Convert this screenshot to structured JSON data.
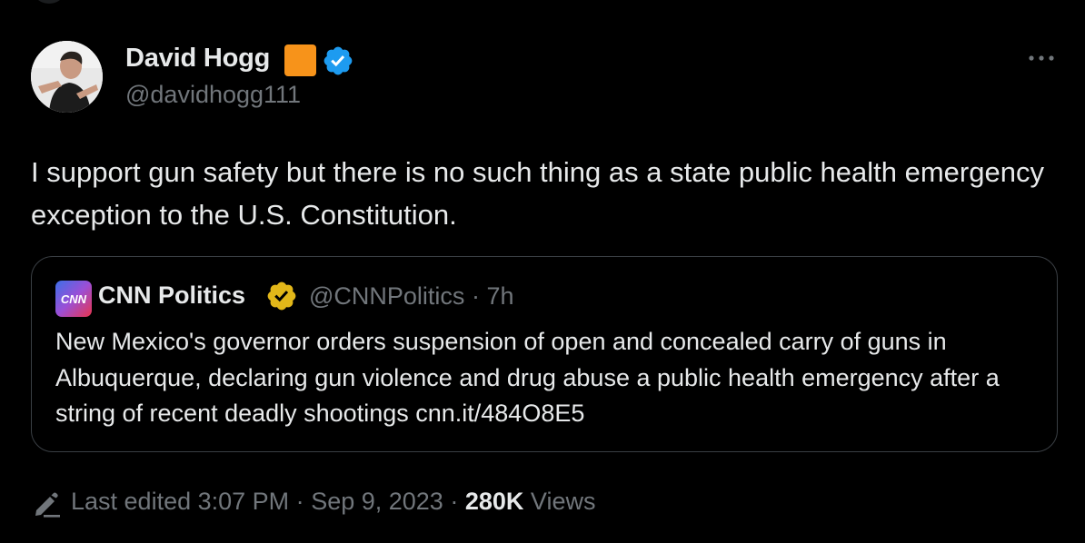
{
  "author": {
    "display_name": "David Hogg",
    "handle": "@davidhogg111",
    "badge_color": "#f7931a",
    "verified_color": "#1d9bf0"
  },
  "tweet": {
    "text": "I support gun safety but there is no such thing as a state public health emergency exception to the U.S. Constitution."
  },
  "quote": {
    "logo_text": "CNN",
    "display_name": "CNN Politics",
    "handle": "@CNNPolitics",
    "separator": "·",
    "time": "7h",
    "text": "New Mexico's governor orders suspension of open and concealed carry of guns in Albuquerque, declaring gun violence and drug abuse a public health emergency after a string of recent deadly shootings cnn.it/484O8E5",
    "verified_color": "#e2b719"
  },
  "footer": {
    "edited_label": "Last edited 3:07 PM",
    "separator": "·",
    "date": "Sep 9, 2023",
    "views_count": "280K",
    "views_label": "Views"
  },
  "icons": {
    "more": "more-horizontal-icon",
    "verified": "verified-badge-icon",
    "edit": "pencil-edit-icon"
  },
  "colors": {
    "background": "#000000",
    "text_primary": "#e7e9ea",
    "text_secondary": "#71767b",
    "border": "#3a3f44"
  }
}
